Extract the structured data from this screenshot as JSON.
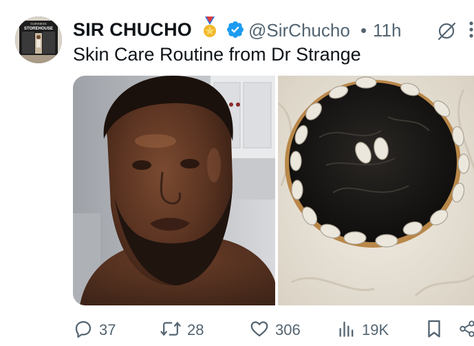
{
  "post": {
    "author": {
      "display_name": "SIR CHUCHO",
      "handle": "@SirChucho",
      "separator": "•",
      "time": "11h",
      "avatar_sign": "STOREHOUSE",
      "avatar_sign_top": "GUINNESS"
    },
    "text": "Skin Care Routine from Dr Strange",
    "media": [
      {
        "kind": "photo",
        "subject": "selfie"
      },
      {
        "kind": "photo",
        "subject": "calabash bowl with cowrie shells"
      }
    ],
    "actions": {
      "replies": "37",
      "reposts": "28",
      "likes": "306",
      "views": "19K"
    }
  },
  "icons": {
    "medal": "medal-icon",
    "verified": "verified-badge-icon",
    "grok": "grok-icon",
    "more": "more-options-icon",
    "reply": "reply-icon",
    "repost": "repost-icon",
    "like": "heart-icon",
    "views": "views-icon",
    "bookmark": "bookmark-icon",
    "share": "share-icon"
  },
  "colors": {
    "text": "#0f1419",
    "secondary": "#536471",
    "verified": "#1d9bf0"
  }
}
